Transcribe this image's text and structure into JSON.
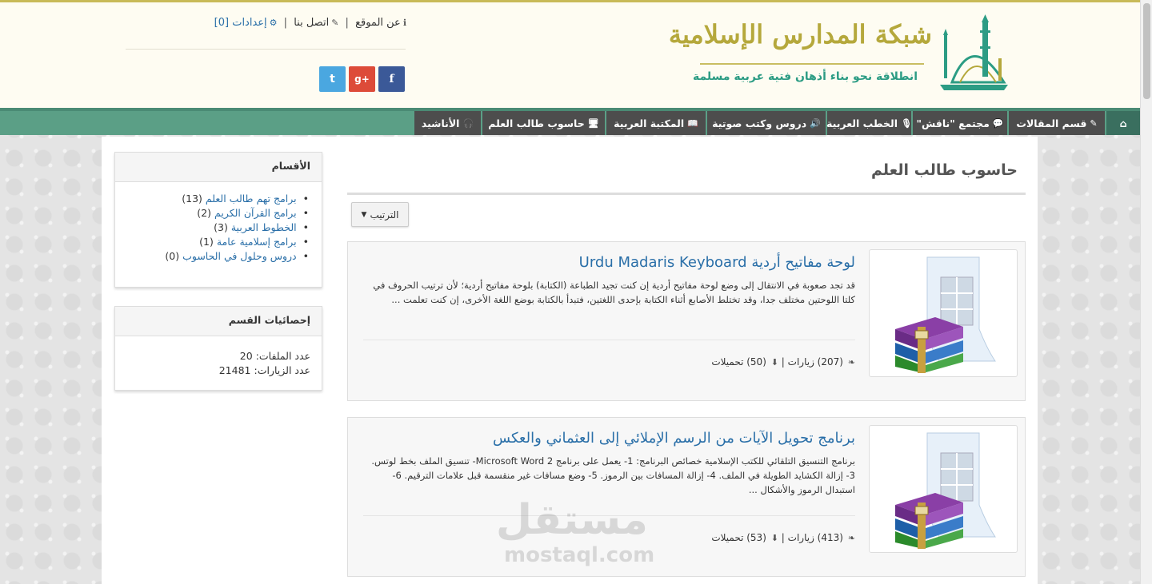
{
  "header": {
    "site_title": "شبكة المدارس الإسلامية",
    "slogan": "انطلاقة نحو بناء أذهان فتية عربية مسلمة",
    "links": {
      "about": "عن الموقع",
      "contact": "اتصل بنا",
      "settings": "إعدادات [0]",
      "separator": "|"
    },
    "social": {
      "facebook": "f",
      "googleplus": "g+",
      "twitter": "t"
    }
  },
  "nav": {
    "items": [
      {
        "label": "قسم المقالات",
        "icon": "pencil-icon"
      },
      {
        "label": "مجتمع \"ناقش\"",
        "icon": "comments-icon"
      },
      {
        "label": "الخطب العربية",
        "icon": "microphone-icon"
      },
      {
        "label": "دروس وكتب صوتية",
        "icon": "volume-icon"
      },
      {
        "label": "المكتبة العربية",
        "icon": "book-icon"
      },
      {
        "label": "حاسوب طالب العلم",
        "icon": "desktop-icon"
      },
      {
        "label": "الأناشيد",
        "icon": "headphones-icon"
      }
    ]
  },
  "sidebar": {
    "categories": {
      "title": "الأقسام",
      "items": [
        {
          "label": "برامج تهم طالب العلم",
          "count": "(13)"
        },
        {
          "label": "برامج القرآن الكريم",
          "count": "(2)"
        },
        {
          "label": "الخطوط العربية",
          "count": "(3)"
        },
        {
          "label": "برامج إسلامية عامة",
          "count": "(1)"
        },
        {
          "label": "دروس وحلول في الحاسوب",
          "count": "(0)"
        }
      ]
    },
    "stats": {
      "title": "إحصائيات القسم",
      "files_label": "عدد الملفات:",
      "files_value": "20",
      "visits_label": "عدد الزيارات:",
      "visits_value": "21481"
    }
  },
  "main": {
    "page_title": "حاسوب طالب العلم",
    "sort_label": "الترتيب",
    "items": [
      {
        "title": "لوحة مفاتيح أردية Urdu Madaris Keyboard",
        "description": "قد تجد صعوبة في الانتقال إلى وضع لوحة مفاتيح أردية إن كنت تجيد الطباعة (الكتابة) بلوحة مفاتيح أردية؛ لأن ترتيب الحروف في كلتا اللوحتين مختلف جدا، وقد تختلط الأصابع أثناء الكتابة بإحدى اللغتين، فتبدأ بالكتابة بوضع اللغة الأخرى، إن كنت تعلمت ...",
        "visits": "(207) زيارات",
        "downloads": "(50) تحميلات",
        "sep": "|"
      },
      {
        "title": "برنامج تحويل الآيات من الرسم الإملائي إلى العثماني والعكس",
        "description": "برنامج التنسيق التلقائي للكتب الإسلامية خصائص البرنامج: 1- يعمل على برنامج Microsoft Word 2- تنسيق الملف بخط لوتس. 3- إزالة الكشايد الطويلة في الملف. 4- إزالة المسافات بين الرموز. 5- وضع مسافات غير منقسمة قبل علامات الترقيم. 6- استبدال الرموز والأشكال ...",
        "visits": "(413) زيارات",
        "downloads": "(53) تحميلات",
        "sep": "|"
      }
    ]
  },
  "watermark": {
    "arabic": "مستقل",
    "latin": "mostaql.com"
  },
  "colors": {
    "nav_green": "#5b9f86",
    "nav_item": "#4d4d4d",
    "link_blue": "#2a6fa8",
    "logo_gold": "#b5a83c",
    "logo_green": "#2c9c84"
  }
}
